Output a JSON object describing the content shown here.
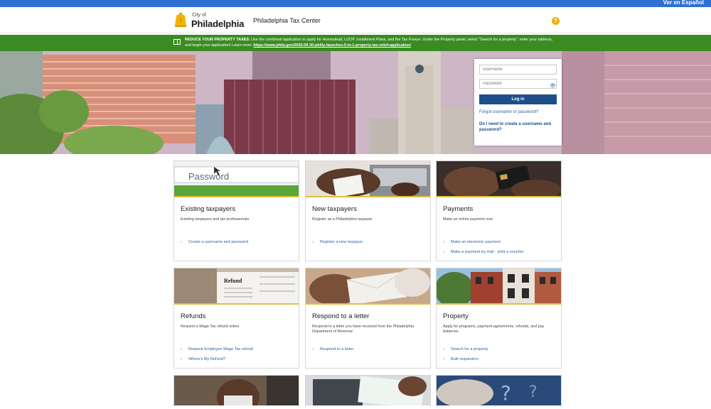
{
  "topbar": {
    "language_link": "Ver en Español"
  },
  "header": {
    "logo_city": "City of",
    "logo_name": "Philadelphia",
    "site_name": "Philadelphia Tax Center",
    "help_icon": "question-circle-icon",
    "help_label": "?"
  },
  "notice": {
    "lead": "REDUCE YOUR PROPERTY TAXES:",
    "body": " Use the combined application to apply for Homestead, LOOP, Installment Plans, and the Tax Freeze. Under the Property panel, select \"Search for a property\", enter your address, and begin your application! Learn more: ",
    "link": "https://www.phila.gov/2025-09-30-philly-launches-5-in-1-property-tax-relief-application/",
    "icon": "book-icon"
  },
  "login": {
    "username_placeholder": "Username",
    "password_placeholder": "Password",
    "show_password_icon": "eye-icon",
    "show_password_glyph": "👁",
    "login_button": "Log in",
    "forgot_link": "Forgot username or password?",
    "need_account_link": "Do I need to create a username and password?"
  },
  "cards": [
    {
      "title": "Existing taxpayers",
      "description": "Existing taxpayers and tax professionals",
      "links": [
        "Create a username and password"
      ]
    },
    {
      "title": "New taxpayers",
      "description": "Register as a Philadelphia taxpayer",
      "links": [
        "Register a new taxpayer"
      ]
    },
    {
      "title": "Payments",
      "description": "Make an online payment now",
      "links": [
        "Make an electronic payment",
        "Make a payment by mail - print a voucher"
      ]
    },
    {
      "title": "Refunds",
      "description": "Request a Wage Tax refund online",
      "links": [
        "Request Employee Wage Tax refund",
        "Where's My Refund?"
      ]
    },
    {
      "title": "Respond to a letter",
      "description": "Respond to a letter you have received from the Philadelphia Department of Revenue",
      "links": [
        "Respond to a letter"
      ]
    },
    {
      "title": "Property",
      "description": "Apply for programs, payment agreements, refunds, and pay balances",
      "links": [
        "Search for a property",
        "Bulk requestors"
      ]
    }
  ],
  "card_image_text": {
    "password_word": "Password",
    "refund_word": "Refund"
  },
  "colors": {
    "topbar": "#2f6fd1",
    "notice_bg": "#3a8c22",
    "link": "#2a5fa5",
    "login_button": "#1e4f8a",
    "card_accent": "#e0c040",
    "help": "#e8b200"
  }
}
